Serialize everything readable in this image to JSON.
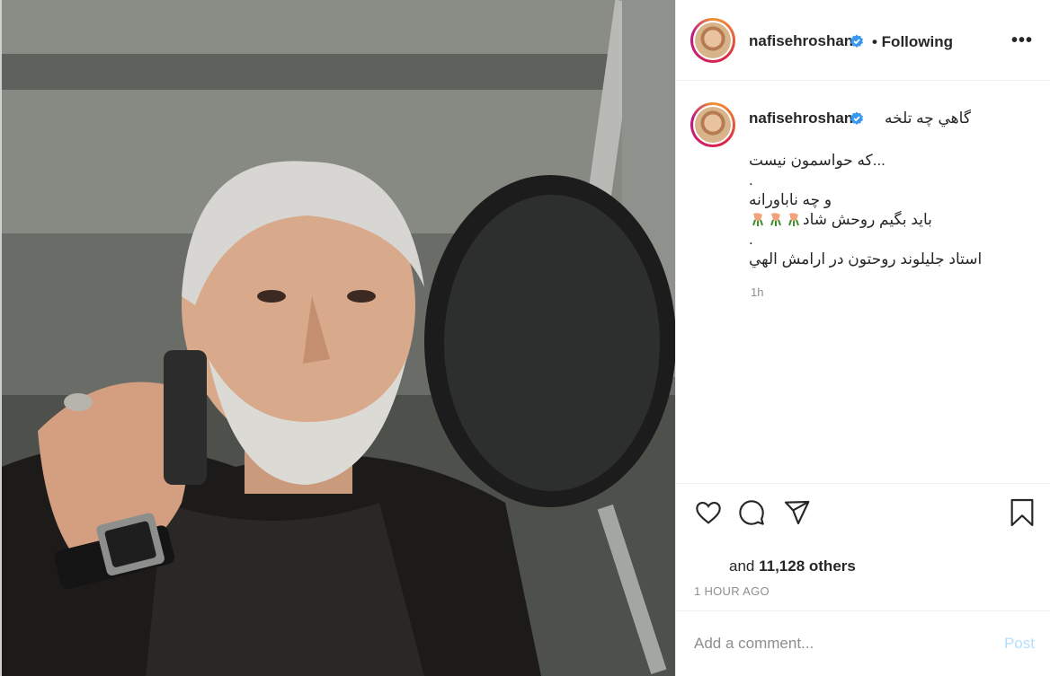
{
  "post": {
    "username": "nafisehroshan",
    "following_label": "• Following",
    "more_label": "•••",
    "caption": {
      "first_line": "گاهي چه تلخه",
      "lines": [
        "...که حواسمون نيست",
        ".",
        "و چه ناباورانه",
        "بايد بگيم روحش شاد",
        ".",
        "استاد جليلوند روحتون در ارامش الهي"
      ],
      "emoji_line_index": 3,
      "emoji_count": 3,
      "relative_time": "1h"
    },
    "likes": {
      "prefix": "and",
      "count": "11,128 others"
    },
    "posted_time": "1 HOUR AGO",
    "comment": {
      "placeholder": "Add a comment...",
      "post_label": "Post"
    }
  },
  "colors": {
    "verified": "#3897f0",
    "post_disabled": "#b2dffc",
    "muted_text": "#8e8e8e"
  },
  "icons": [
    "heart-icon",
    "comment-icon",
    "share-icon",
    "bookmark-icon",
    "verified-badge-icon",
    "more-options-icon"
  ]
}
